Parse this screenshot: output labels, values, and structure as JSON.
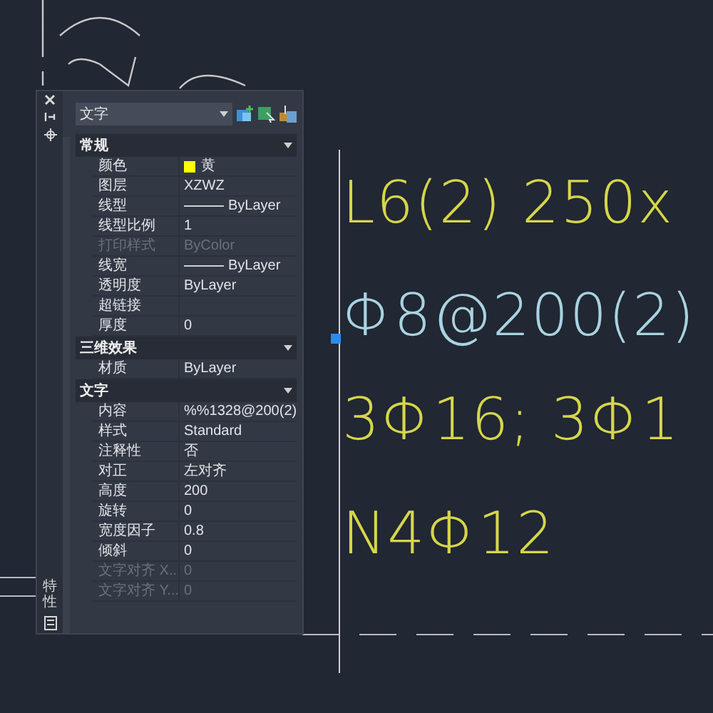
{
  "palette": {
    "title": "特性",
    "object_type": "文字",
    "sections": [
      {
        "title": "常规",
        "expanded": true,
        "rows": [
          {
            "label": "颜色",
            "value": "黄",
            "kind": "color",
            "color": "#ffff00",
            "disabled": false
          },
          {
            "label": "图层",
            "value": "XZWZ",
            "kind": "text",
            "disabled": false
          },
          {
            "label": "线型",
            "value": "ByLayer",
            "kind": "line",
            "disabled": false
          },
          {
            "label": "线型比例",
            "value": "1",
            "kind": "text",
            "disabled": false
          },
          {
            "label": "打印样式",
            "value": "ByColor",
            "kind": "text",
            "disabled": true
          },
          {
            "label": "线宽",
            "value": "ByLayer",
            "kind": "line",
            "disabled": false
          },
          {
            "label": "透明度",
            "value": "ByLayer",
            "kind": "text",
            "disabled": false
          },
          {
            "label": "超链接",
            "kind": "text",
            "disabled": false
          },
          {
            "label": "厚度",
            "value": "0",
            "kind": "text",
            "disabled": false
          }
        ]
      },
      {
        "title": "三维效果",
        "expanded": true,
        "rows": [
          {
            "label": "材质",
            "value": "ByLayer",
            "kind": "text",
            "disabled": false
          }
        ]
      },
      {
        "title": "文字",
        "expanded": true,
        "rows": [
          {
            "label": "内容",
            "value": "%%1328@200(2)",
            "kind": "text",
            "disabled": false
          },
          {
            "label": "样式",
            "value": "Standard",
            "kind": "text",
            "disabled": false
          },
          {
            "label": "注释性",
            "value": "否",
            "kind": "text",
            "disabled": false
          },
          {
            "label": "对正",
            "value": "左对齐",
            "kind": "text",
            "disabled": false
          },
          {
            "label": "高度",
            "value": "200",
            "kind": "text",
            "disabled": false
          },
          {
            "label": "旋转",
            "value": "0",
            "kind": "text",
            "disabled": false
          },
          {
            "label": "宽度因子",
            "value": "0.8",
            "kind": "text",
            "disabled": false
          },
          {
            "label": "倾斜",
            "value": "0",
            "kind": "text",
            "disabled": false
          },
          {
            "label": "文字对齐 X...",
            "value": "0",
            "kind": "text",
            "disabled": true
          },
          {
            "label": "文字对齐 Y...",
            "value": "0",
            "kind": "text",
            "disabled": true
          }
        ]
      }
    ]
  },
  "canvas": {
    "texts": [
      {
        "text": "L6(2) 250x",
        "color": "#d6d64a",
        "selected": false
      },
      {
        "text": "Φ8@200(2)",
        "color": "#a9d3e0",
        "selected": true
      },
      {
        "text": "3Φ16; 3Φ1",
        "color": "#d6d64a",
        "selected": false
      },
      {
        "text": "N4Φ12",
        "color": "#d6d64a",
        "selected": false
      }
    ]
  }
}
